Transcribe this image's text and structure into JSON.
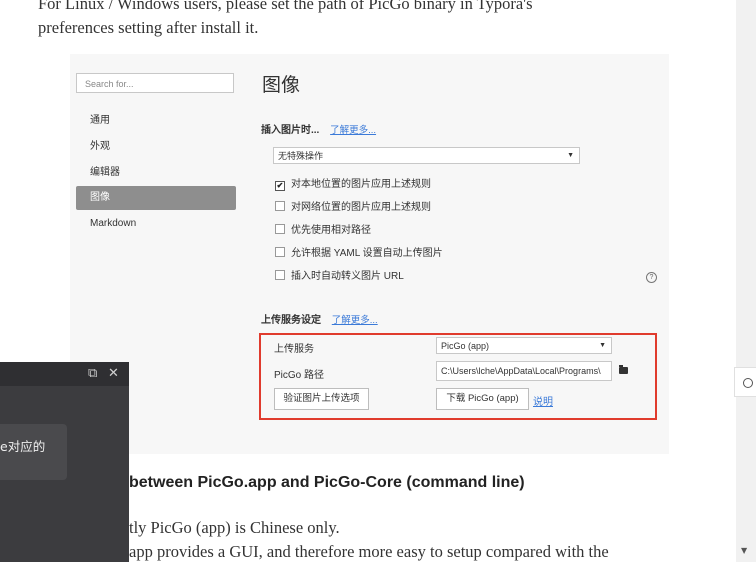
{
  "document": {
    "para1_line1": "For Linux / Windows users, please set the path of PicGo binary in Typora's",
    "para1_line2": "preferences setting after install it.",
    "heading": "between PicGo.app and PicGo-Core (command line)",
    "para2_line1": "tly PicGo (app) is Chinese only.",
    "para2_line2": "app provides a GUI, and therefore more easy to setup compared with the"
  },
  "screenshot": {
    "search_placeholder": "Search for...",
    "nav": [
      "通用",
      "外观",
      "编辑器",
      "图像",
      "Markdown"
    ],
    "active_nav": "图像",
    "title": "图像",
    "insert_label": "插入图片时...",
    "insert_link": "了解更多...",
    "insert_select": "无特殊操作",
    "checkboxes": [
      {
        "label": "对本地位置的图片应用上述规则",
        "checked": "✔"
      },
      {
        "label": "对网络位置的图片应用上述规则",
        "checked": ""
      },
      {
        "label": "优先使用相对路径",
        "checked": ""
      },
      {
        "label": "允许根据 YAML 设置自动上传图片",
        "checked": ""
      },
      {
        "label": "插入时自动转义图片 URL",
        "checked": ""
      }
    ],
    "help_icon": "?",
    "upload_label": "上传服务设定",
    "upload_link": "了解更多...",
    "service_label": "上传服务",
    "service_value": "PicGo (app)",
    "path_label": "PicGo 路径",
    "path_value": "C:\\Users\\lche\\AppData\\Local\\Programs\\",
    "verify_button": "验证图片上传选项",
    "download_button": "下载 PicGo (app)",
    "explain_link": "说明",
    "accent_red": "#e03b2d"
  },
  "overlay": {
    "restore_icon": "⧉",
    "close_icon": "✕",
    "card_text": "e对应的"
  },
  "scroll_arrow": "▼"
}
